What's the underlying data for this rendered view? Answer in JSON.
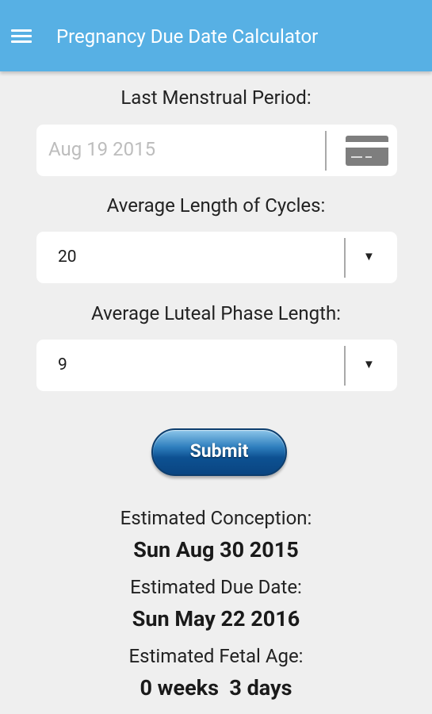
{
  "header": {
    "menu_icon": "hamburger-menu-icon",
    "title": "Pregnancy Due Date Calculator",
    "background_color": "#57b0e4"
  },
  "form": {
    "lmp": {
      "label": "Last Menstrual Period:",
      "placeholder": "Aug 19 2015",
      "icon": "calendar-card-icon"
    },
    "cycle_length": {
      "label": "Average Length of Cycles:",
      "value": "20",
      "arrow": "▼"
    },
    "luteal_length": {
      "label": "Average Luteal Phase Length:",
      "value": "9",
      "arrow": "▼"
    },
    "submit_label": "Submit"
  },
  "results": {
    "conception_label": "Estimated Conception:",
    "conception_value": "Sun Aug 30 2015",
    "due_label": "Estimated Due Date:",
    "due_value": "Sun May 22 2016",
    "fetal_label": "Estimated Fetal Age:",
    "fetal_value": "0 weeks  3 days"
  }
}
